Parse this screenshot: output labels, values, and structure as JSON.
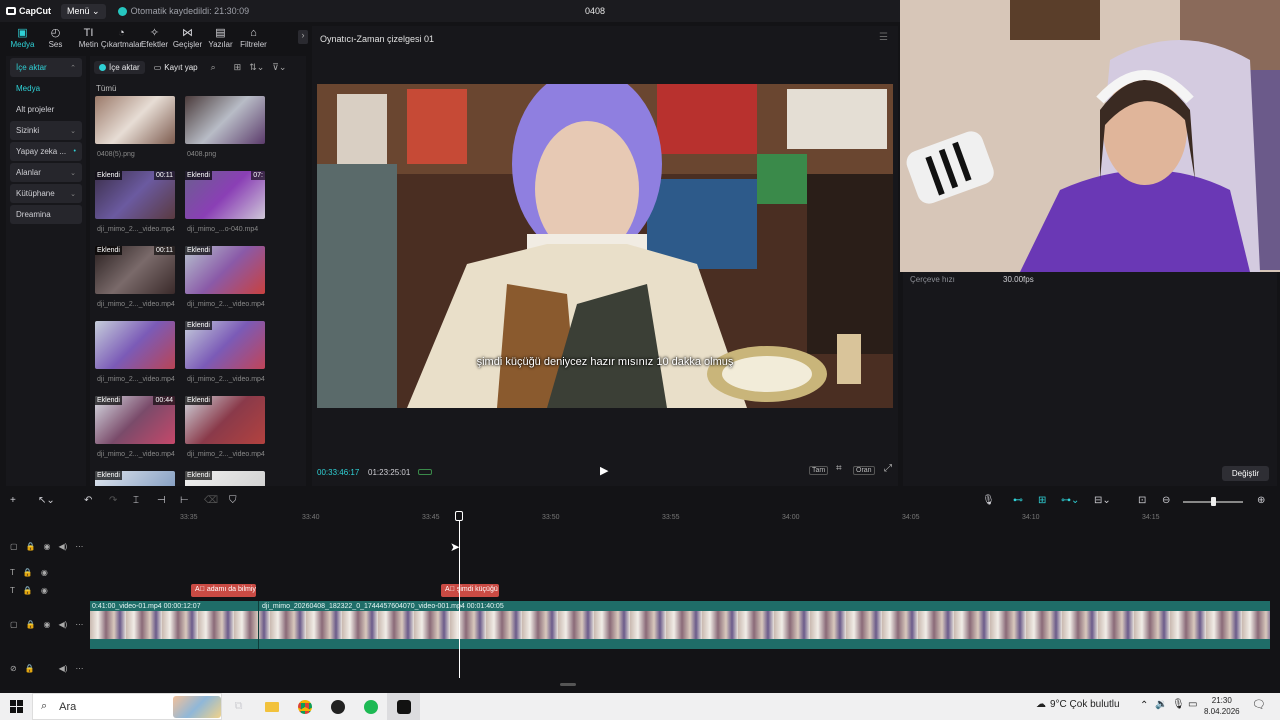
{
  "window": {
    "app_name": "CapCut",
    "menu_label": "Menü",
    "autosave": "Otomatik kaydedildi: 21:30:09",
    "project_name": "0408"
  },
  "toolbar": {
    "tools": [
      {
        "label": "Medya",
        "icon": "media-icon",
        "glyph": "▣"
      },
      {
        "label": "Ses",
        "icon": "audio-icon",
        "glyph": "◴"
      },
      {
        "label": "Metin",
        "icon": "text-icon",
        "glyph": "TI"
      },
      {
        "label": "Çıkartmalar",
        "icon": "sticker-icon",
        "glyph": "◔"
      },
      {
        "label": "Efektler",
        "icon": "effects-icon",
        "glyph": "✧"
      },
      {
        "label": "Geçişler",
        "icon": "transition-icon",
        "glyph": "⋈"
      },
      {
        "label": "Yazılar",
        "icon": "captions-icon",
        "glyph": "▤"
      },
      {
        "label": "Filtreler",
        "icon": "filters-icon",
        "glyph": "⌂"
      }
    ]
  },
  "sidebar": {
    "items": [
      {
        "label": "İçe aktar",
        "chevron": "⌃"
      },
      {
        "label": "Medya",
        "chevron": ""
      },
      {
        "label": "Alt projeler",
        "chevron": ""
      },
      {
        "label": "Sizinki",
        "chevron": "⌄"
      },
      {
        "label": "Yapay zeka ...",
        "chevron": "•"
      },
      {
        "label": "Alanlar",
        "chevron": "⌄"
      },
      {
        "label": "Kütüphane",
        "chevron": "⌄"
      },
      {
        "label": "Dreamina",
        "chevron": ""
      }
    ]
  },
  "media": {
    "import_label": "İçe aktar",
    "record_label": "Kayıt yap",
    "all_label": "Tümü",
    "added_badge": "Eklendi",
    "items": [
      {
        "name": "0408(5).png",
        "duration": "",
        "added": false
      },
      {
        "name": "0408.png",
        "duration": "",
        "added": false
      },
      {
        "name": "dji_mimo_2..._video.mp4",
        "duration": "00:11",
        "added": true
      },
      {
        "name": "dji_mimo_...o-040.mp4",
        "duration": "07:",
        "added": true
      },
      {
        "name": "dji_mimo_2..._video.mp4",
        "duration": "00:11",
        "added": true
      },
      {
        "name": "dji_mimo_2..._video.mp4",
        "duration": "",
        "added": true
      },
      {
        "name": "dji_mimo_2..._video.mp4",
        "duration": "",
        "added": false
      },
      {
        "name": "dji_mimo_2..._video.mp4",
        "duration": "",
        "added": true
      },
      {
        "name": "dji_mimo_2..._video.mp4",
        "duration": "00:44",
        "added": true
      },
      {
        "name": "dji_mimo_2..._video.mp4",
        "duration": "",
        "added": true
      },
      {
        "name": "",
        "duration": "",
        "added": true
      },
      {
        "name": "",
        "duration": "",
        "added": true
      }
    ]
  },
  "player": {
    "title": "Oynatıcı-Zaman çizelgesi 01",
    "subtitle": "şimdi küçüğü deniycez hazır mısınız 10 dakka olmuş",
    "current_time": "00:33:46:17",
    "total_time": "01:23:25:01",
    "full_label": "Tam",
    "ratio_label": "Oran"
  },
  "properties": {
    "fps_label": "Çerçeve hızı",
    "fps_value": "30.00fps",
    "change_button": "Değiştir"
  },
  "timeline": {
    "ruler_ticks": [
      "33:35",
      "33:40",
      "33:45",
      "33:50",
      "33:55",
      "34:00",
      "34:05",
      "34:10",
      "34:15"
    ],
    "captions": [
      {
        "text": "adamı da bilmiy"
      },
      {
        "text": "şimdi küçüğü"
      }
    ],
    "clips": [
      {
        "label": "0:41:00_video-01.mp4   00:00:12:07"
      },
      {
        "label": "dji_mimo_20260408_182322_0_1744457604070_video-001.mp4   00:01:40:05"
      }
    ]
  },
  "taskbar": {
    "search_placeholder": "Ara",
    "weather": "9°C  Çok bulutlu",
    "time": "21:30",
    "date": "8.04.2026"
  }
}
